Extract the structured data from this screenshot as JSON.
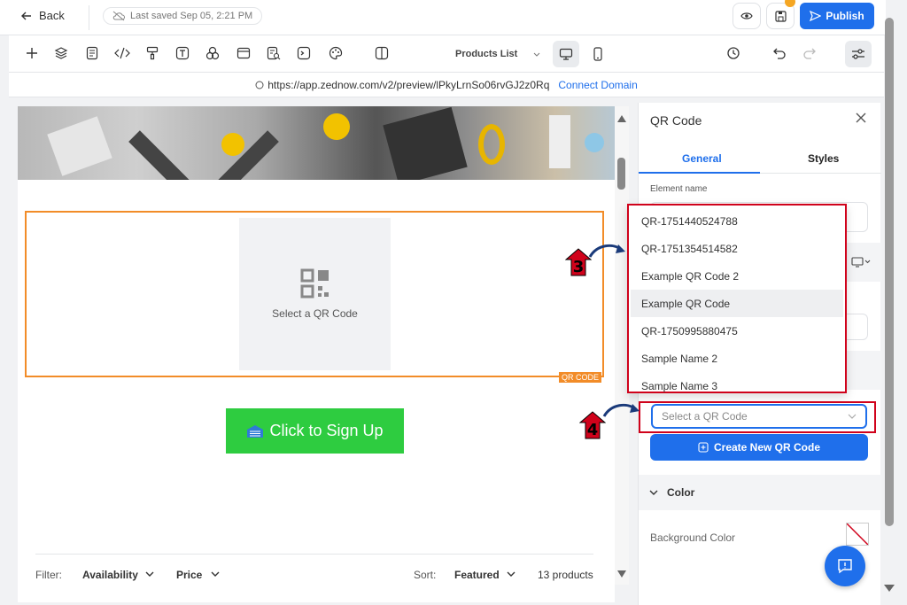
{
  "header": {
    "back_label": "Back",
    "last_saved": "Last saved Sep 05, 2:21 PM",
    "publish_label": "Publish"
  },
  "toolbar": {
    "page_select": "Products List"
  },
  "urlbar": {
    "url": "https://app.zednow.com/v2/preview/lPkyLrnSo06rvGJ2z0Rq",
    "connect_label": "Connect Domain"
  },
  "canvas": {
    "qr_placeholder_label": "Select a QR Code",
    "qr_tag": "QR CODE",
    "signup_label": "Click to Sign Up",
    "filter": {
      "filter_label": "Filter:",
      "availability": "Availability",
      "price": "Price",
      "sort_label": "Sort:",
      "sort_value": "Featured",
      "count": "13 products"
    }
  },
  "panel": {
    "title": "QR Code",
    "tabs": [
      "General",
      "Styles"
    ],
    "element_name_label": "Element name",
    "select_placeholder": "Select a QR Code",
    "create_button": "Create New QR Code",
    "color_section": "Color",
    "background_color_label": "Background Color"
  },
  "dropdown": {
    "items": [
      "QR-1751440524788",
      "QR-1751354514582",
      "Example QR Code 2",
      "Example QR Code",
      "QR-1750995880475",
      "Sample Name 2",
      "Sample Name 3"
    ],
    "hovered_index": 3
  },
  "annotations": {
    "step_3": "3",
    "step_4": "4"
  },
  "colors": {
    "accent": "#1f6feb",
    "selection_outline": "#f28c28",
    "annotation_red": "#d0021b",
    "signup_green": "#2ecc40"
  }
}
